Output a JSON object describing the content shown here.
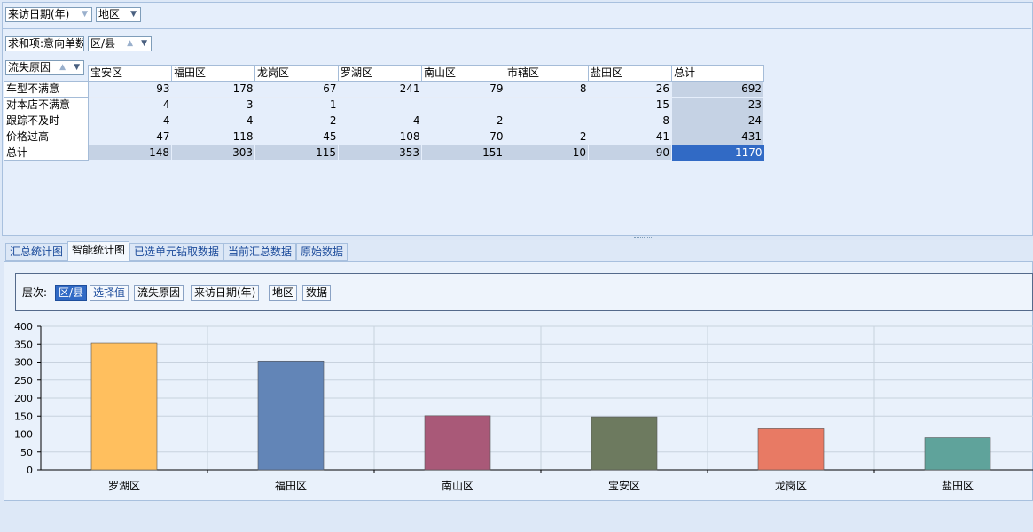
{
  "filters": {
    "filter_fields": [
      {
        "label": "来访日期(年)",
        "arrow": "▼"
      },
      {
        "label": "地区",
        "arrow": "▼"
      }
    ],
    "data_field": {
      "label": "求和项:意向单数"
    },
    "column_field": {
      "label": "区/县",
      "sort": "▲",
      "arrow": "▼"
    },
    "row_field": {
      "label": "流失原因",
      "sort": "▲",
      "arrow": "▼"
    }
  },
  "pivot": {
    "columns": [
      "宝安区",
      "福田区",
      "龙岗区",
      "罗湖区",
      "南山区",
      "市辖区",
      "盐田区",
      "总计"
    ],
    "rows": [
      {
        "label": "车型不满意",
        "values": [
          "93",
          "178",
          "67",
          "241",
          "79",
          "8",
          "26",
          "692"
        ]
      },
      {
        "label": "对本店不满意",
        "values": [
          "4",
          "3",
          "1",
          "",
          "",
          "",
          "15",
          "23"
        ]
      },
      {
        "label": "跟踪不及时",
        "values": [
          "4",
          "4",
          "2",
          "4",
          "2",
          "",
          "8",
          "24"
        ]
      },
      {
        "label": "价格过高",
        "values": [
          "47",
          "118",
          "45",
          "108",
          "70",
          "2",
          "41",
          "431"
        ]
      },
      {
        "label": "总计",
        "values": [
          "148",
          "303",
          "115",
          "353",
          "151",
          "10",
          "90",
          "1170"
        ]
      }
    ]
  },
  "tabs": [
    "汇总统计图",
    "智能统计图",
    "已选单元钻取数据",
    "当前汇总数据",
    "原始数据"
  ],
  "active_tab": "智能统计图",
  "levels": {
    "label": "层次:",
    "items": [
      "区/县",
      "选择值",
      "流失原因",
      "来访日期(年)",
      "地区",
      "数据"
    ]
  },
  "colors": {
    "accent": "#316ac5",
    "bars": [
      "#ffbf5e",
      "#6285b7",
      "#a95978",
      "#6d7a5f",
      "#e87a64",
      "#5fa39b"
    ]
  },
  "chart_data": {
    "type": "bar",
    "categories": [
      "罗湖区",
      "福田区",
      "南山区",
      "宝安区",
      "龙岗区",
      "盐田区"
    ],
    "values": [
      353,
      303,
      151,
      148,
      115,
      90
    ],
    "ylim": [
      0,
      400
    ],
    "yticks": [
      "0",
      "50",
      "100",
      "150",
      "200",
      "250",
      "300",
      "350",
      "400"
    ],
    "grid": true,
    "title": "",
    "xlabel": "",
    "ylabel": ""
  }
}
